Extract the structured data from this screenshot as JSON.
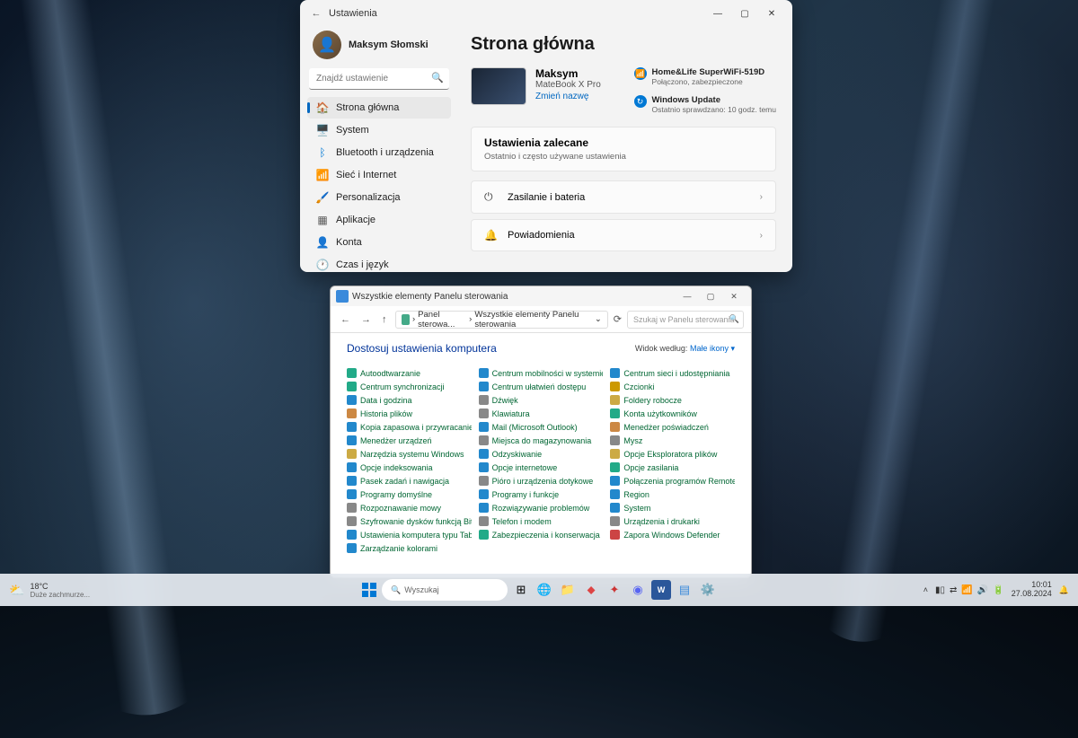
{
  "settings": {
    "title": "Ustawienia",
    "profile_name": "Maksym Słomski",
    "search_placeholder": "Znajdź ustawienie",
    "nav": [
      {
        "icon": "🏠",
        "label": "Strona główna",
        "active": true,
        "color": "#e67e00"
      },
      {
        "icon": "🖥️",
        "label": "System",
        "color": "#0078d4"
      },
      {
        "icon": "ᛒ",
        "label": "Bluetooth i urządzenia",
        "color": "#0078d4"
      },
      {
        "icon": "📶",
        "label": "Sieć i Internet",
        "color": "#00b7c3"
      },
      {
        "icon": "🖌️",
        "label": "Personalizacja",
        "color": "#c84e00"
      },
      {
        "icon": "▦",
        "label": "Aplikacje",
        "color": "#5a5a5a"
      },
      {
        "icon": "👤",
        "label": "Konta",
        "color": "#2aa82a"
      },
      {
        "icon": "🕐",
        "label": "Czas i język",
        "color": "#555"
      }
    ],
    "page_title": "Strona główna",
    "device": {
      "name": "Maksym",
      "model": "MateBook X Pro",
      "rename": "Zmień nazwę"
    },
    "status": {
      "wifi": {
        "title": "Home&Life SuperWiFi-519D",
        "sub": "Połączono, zabezpieczone"
      },
      "update": {
        "title": "Windows Update",
        "sub": "Ostatnio sprawdzano: 10 godz. temu"
      }
    },
    "recommended": {
      "title": "Ustawienia zalecane",
      "sub": "Ostatnio i często używane ustawienia"
    },
    "rec_items": [
      {
        "icon": "⏻",
        "label": "Zasilanie i bateria"
      },
      {
        "icon": "🔔",
        "label": "Powiadomienia"
      }
    ]
  },
  "cp": {
    "title": "Wszystkie elementy Panelu sterowania",
    "crumb1": "Panel sterowa...",
    "crumb2": "Wszystkie elementy Panelu sterowania",
    "search_placeholder": "Szukaj w Panelu sterowania",
    "heading": "Dostosuj ustawienia komputera",
    "view_label": "Widok według:",
    "view_value": "Małe ikony ▾",
    "items": [
      {
        "c": "#2a8",
        "t": "Autoodtwarzanie"
      },
      {
        "c": "#28c",
        "t": "Centrum mobilności w systemie Win..."
      },
      {
        "c": "#28c",
        "t": "Centrum sieci i udostępniania"
      },
      {
        "c": "#2a8",
        "t": "Centrum synchronizacji"
      },
      {
        "c": "#28c",
        "t": "Centrum ułatwień dostępu"
      },
      {
        "c": "#c90",
        "t": "Czcionki"
      },
      {
        "c": "#28c",
        "t": "Data i godzina"
      },
      {
        "c": "#888",
        "t": "Dźwięk"
      },
      {
        "c": "#ca4",
        "t": "Foldery robocze"
      },
      {
        "c": "#c84",
        "t": "Historia plików"
      },
      {
        "c": "#888",
        "t": "Klawiatura"
      },
      {
        "c": "#2a8",
        "t": "Konta użytkowników"
      },
      {
        "c": "#28c",
        "t": "Kopia zapasowa i przywracanie (Win..."
      },
      {
        "c": "#28c",
        "t": "Mail (Microsoft Outlook)"
      },
      {
        "c": "#c84",
        "t": "Menedżer poświadczeń"
      },
      {
        "c": "#28c",
        "t": "Menedżer urządzeń"
      },
      {
        "c": "#888",
        "t": "Miejsca do magazynowania"
      },
      {
        "c": "#888",
        "t": "Mysz"
      },
      {
        "c": "#ca4",
        "t": "Narzędzia systemu Windows"
      },
      {
        "c": "#28c",
        "t": "Odzyskiwanie"
      },
      {
        "c": "#ca4",
        "t": "Opcje Eksploratora plików"
      },
      {
        "c": "#28c",
        "t": "Opcje indeksowania"
      },
      {
        "c": "#28c",
        "t": "Opcje internetowe"
      },
      {
        "c": "#2a8",
        "t": "Opcje zasilania"
      },
      {
        "c": "#28c",
        "t": "Pasek zadań i nawigacja"
      },
      {
        "c": "#888",
        "t": "Pióro i urządzenia dotykowe"
      },
      {
        "c": "#28c",
        "t": "Połączenia programów RemoteApp i..."
      },
      {
        "c": "#28c",
        "t": "Programy domyślne"
      },
      {
        "c": "#28c",
        "t": "Programy i funkcje"
      },
      {
        "c": "#28c",
        "t": "Region"
      },
      {
        "c": "#888",
        "t": "Rozpoznawanie mowy"
      },
      {
        "c": "#28c",
        "t": "Rozwiązywanie problemów"
      },
      {
        "c": "#28c",
        "t": "System"
      },
      {
        "c": "#888",
        "t": "Szyfrowanie dysków funkcją BitLocker"
      },
      {
        "c": "#888",
        "t": "Telefon i modem"
      },
      {
        "c": "#888",
        "t": "Urządzenia i drukarki"
      },
      {
        "c": "#28c",
        "t": "Ustawienia komputera typu Tablet"
      },
      {
        "c": "#2a8",
        "t": "Zabezpieczenia i konserwacja"
      },
      {
        "c": "#c44",
        "t": "Zapora Windows Defender"
      },
      {
        "c": "#28c",
        "t": "Zarządzanie kolorami"
      }
    ]
  },
  "taskbar": {
    "weather_temp": "18°C",
    "weather_desc": "Duże zachmurze...",
    "search": "Wyszukaj",
    "time": "10:01",
    "date": "27.08.2024"
  }
}
